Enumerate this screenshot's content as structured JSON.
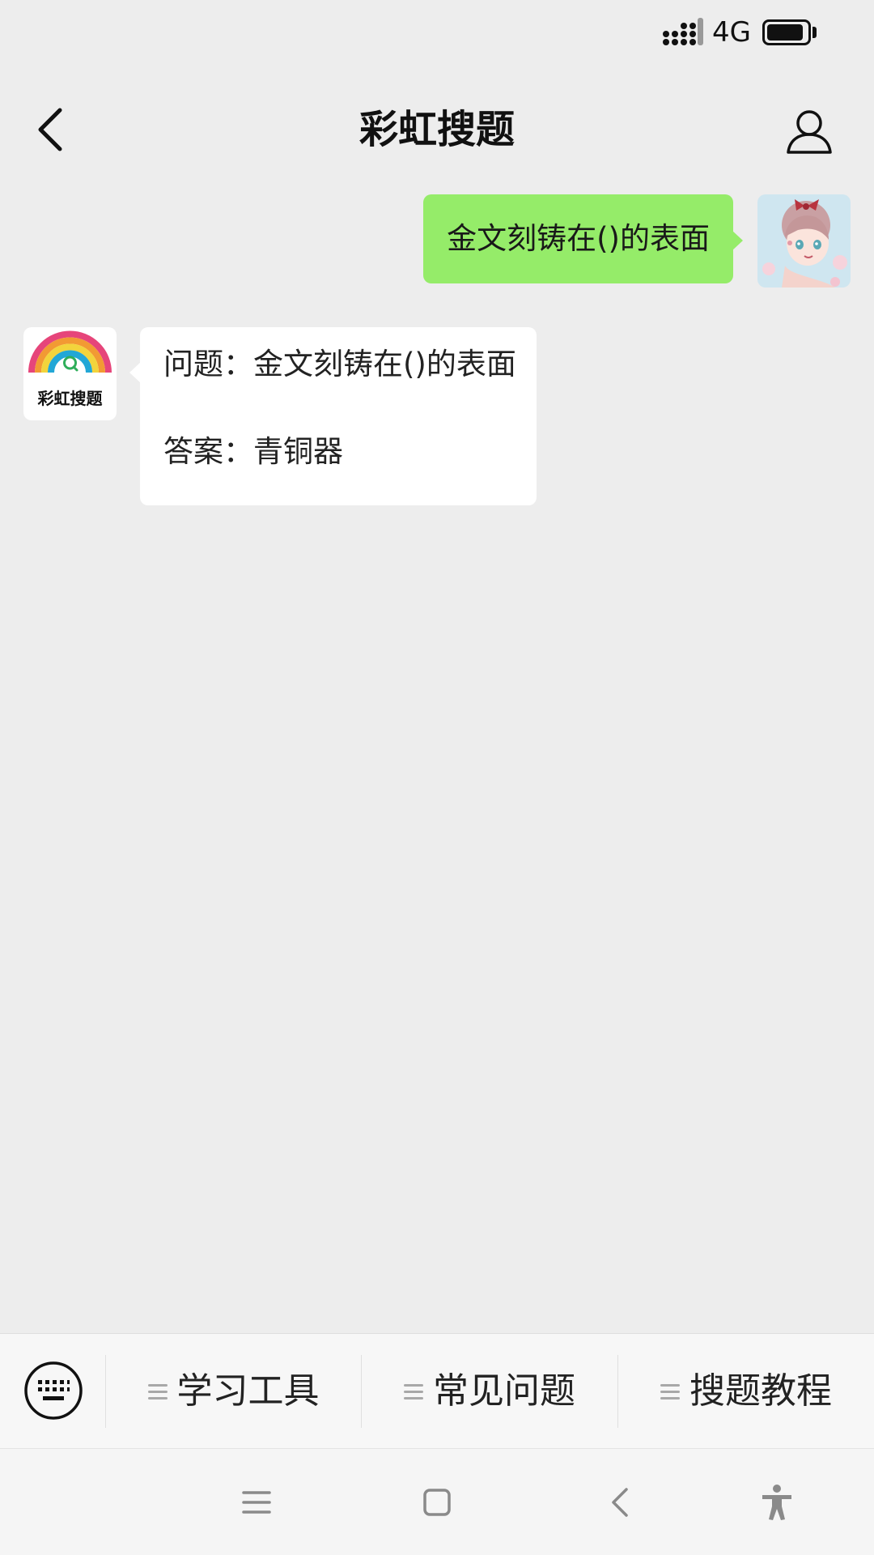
{
  "status_bar": {
    "network_type": "4G",
    "battery_level": 0.92
  },
  "header": {
    "title": "彩虹搜题"
  },
  "messages": {
    "outgoing": {
      "text": "金文刻铸在()的表面"
    },
    "incoming": {
      "bot_name": "彩虹搜题",
      "question_line": "问题：金文刻铸在()的表面",
      "answer_line": "答案：青铜器"
    }
  },
  "menu": {
    "items": [
      {
        "label": "学习工具"
      },
      {
        "label": "常见问题"
      },
      {
        "label": "搜题教程"
      }
    ]
  },
  "colors": {
    "outgoing_bubble": "#95ec69",
    "incoming_bubble": "#ffffff",
    "background": "#ededed"
  },
  "icons": {
    "back": "chevron-left-icon",
    "profile": "person-outline-icon",
    "keyboard": "keyboard-icon",
    "menu_item": "menu-lines-icon",
    "system_menu": "hamburger-icon",
    "system_home": "square-icon",
    "system_back": "chevron-left-icon",
    "accessibility": "accessibility-icon"
  }
}
